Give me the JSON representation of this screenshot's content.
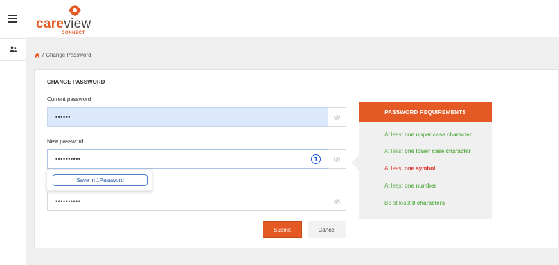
{
  "app": {
    "logo_care": "care",
    "logo_view": "view",
    "logo_sub": "CONNECT",
    "accent_color": "#e55a24"
  },
  "breadcrumb": {
    "home_icon": "home-icon",
    "separator": "/",
    "current": "Change Password"
  },
  "form": {
    "title": "CHANGE PASSWORD",
    "current_label": "Current password",
    "current_value": "••••••",
    "new_label": "New password",
    "new_value": "••••••••••",
    "confirm_value": "••••••••••",
    "submit_label": "Submit",
    "cancel_label": "Cancel"
  },
  "password_manager": {
    "save_label": "Save in 1Password",
    "icon_glyph": "1"
  },
  "requirements": {
    "title": "PASSWORD REQUIREMENTS",
    "items": [
      {
        "prefix": "At least ",
        "bold": "one upper case character",
        "status": "met"
      },
      {
        "prefix": "At least ",
        "bold": "one lower case character",
        "status": "met"
      },
      {
        "prefix": "At least ",
        "bold": "one symbol",
        "status": "unmet"
      },
      {
        "prefix": "At least ",
        "bold": "one number",
        "status": "met"
      },
      {
        "prefix": "Be at least ",
        "bold": "8 characters",
        "status": "met"
      }
    ],
    "met_color": "#5cae49",
    "unmet_color": "#d93025"
  }
}
